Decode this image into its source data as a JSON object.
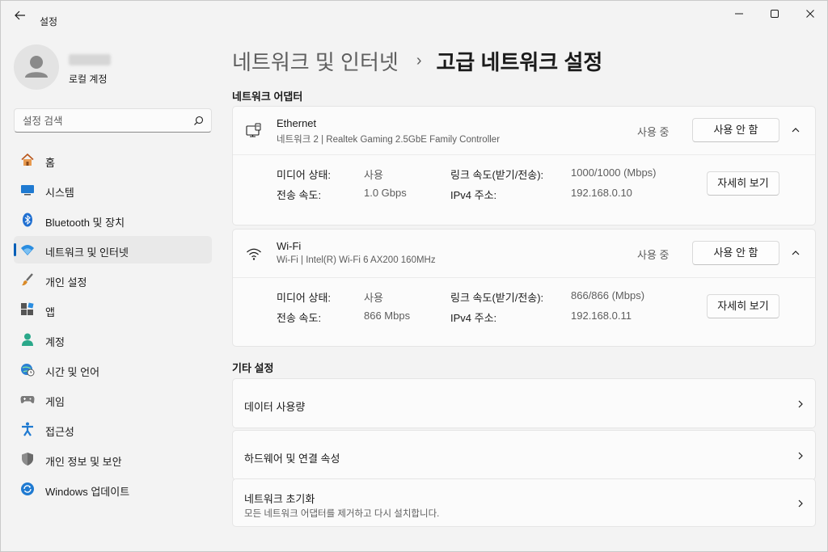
{
  "window": {
    "app_title": "설정",
    "controls": [
      "minimize-icon",
      "maximize-icon",
      "close-icon"
    ]
  },
  "profile": {
    "account_type": "로컬 계정"
  },
  "search": {
    "placeholder": "설정 검색"
  },
  "nav": {
    "items": [
      {
        "label": "홈",
        "icon": "home-icon",
        "active": false
      },
      {
        "label": "시스템",
        "icon": "system-icon",
        "active": false
      },
      {
        "label": "Bluetooth 및 장치",
        "icon": "bluetooth-icon",
        "active": false
      },
      {
        "label": "네트워크 및 인터넷",
        "icon": "wifi-icon",
        "active": true
      },
      {
        "label": "개인 설정",
        "icon": "brush-icon",
        "active": false
      },
      {
        "label": "앱",
        "icon": "apps-icon",
        "active": false
      },
      {
        "label": "계정",
        "icon": "account-icon",
        "active": false
      },
      {
        "label": "시간 및 언어",
        "icon": "globe-clock-icon",
        "active": false
      },
      {
        "label": "게임",
        "icon": "gamepad-icon",
        "active": false
      },
      {
        "label": "접근성",
        "icon": "accessibility-icon",
        "active": false
      },
      {
        "label": "개인 정보 및 보안",
        "icon": "shield-icon",
        "active": false
      },
      {
        "label": "Windows 업데이트",
        "icon": "update-icon",
        "active": false
      }
    ]
  },
  "breadcrumb": {
    "parent": "네트워크 및 인터넷",
    "separator": "›",
    "current": "고급 네트워크 설정"
  },
  "adapters_section": {
    "title": "네트워크 어댑터",
    "adapters": [
      {
        "name": "Ethernet",
        "description": "네트워크 2 | Realtek Gaming 2.5GbE Family Controller",
        "status": "사용 중",
        "disable_label": "사용 안 함",
        "details_label": "자세히 보기",
        "media_state_label": "미디어 상태:",
        "media_state": "사용",
        "speed_label": "전송 속도:",
        "speed": "1.0 Gbps",
        "link_speed_label": "링크 속도(받기/전송):",
        "link_speed": "1000/1000 (Mbps)",
        "ipv4_label": "IPv4 주소:",
        "ipv4": "192.168.0.10"
      },
      {
        "name": "Wi-Fi",
        "description": "Wi-Fi | Intel(R) Wi-Fi 6 AX200 160MHz",
        "status": "사용 중",
        "disable_label": "사용 안 함",
        "details_label": "자세히 보기",
        "media_state_label": "미디어 상태:",
        "media_state": "사용",
        "speed_label": "전송 속도:",
        "speed": "866 Mbps",
        "link_speed_label": "링크 속도(받기/전송):",
        "link_speed": "866/866 (Mbps)",
        "ipv4_label": "IPv4 주소:",
        "ipv4": "192.168.0.11"
      }
    ]
  },
  "other_section": {
    "title": "기타 설정",
    "items": [
      {
        "title": "데이터 사용량"
      },
      {
        "title": "하드웨어 및 연결 속성"
      },
      {
        "title": "네트워크 초기화",
        "subtitle": "모든 네트워크 어댑터를 제거하고 다시 설치합니다."
      }
    ]
  },
  "colors": {
    "accent": "#005fb8",
    "background": "#f3f3f3",
    "card": "#fbfbfb"
  }
}
